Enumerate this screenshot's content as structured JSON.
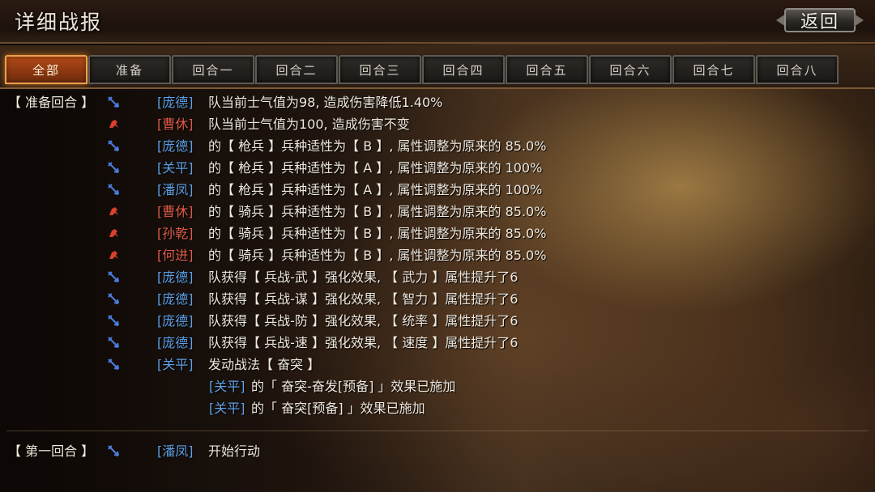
{
  "header": {
    "title": "详细战报",
    "back_label": "返回"
  },
  "tabs": [
    {
      "label": "全部",
      "active": true
    },
    {
      "label": "准备",
      "active": false
    },
    {
      "label": "回合一",
      "active": false
    },
    {
      "label": "回合二",
      "active": false
    },
    {
      "label": "回合三",
      "active": false
    },
    {
      "label": "回合四",
      "active": false
    },
    {
      "label": "回合五",
      "active": false
    },
    {
      "label": "回合六",
      "active": false
    },
    {
      "label": "回合七",
      "active": false
    },
    {
      "label": "回合八",
      "active": false
    }
  ],
  "colors": {
    "ally_blue": "#5ea0e6",
    "enemy_red": "#e05c4a",
    "tab_active": "#b34a16"
  },
  "icons": {
    "ally": "blue-arrow-icon",
    "enemy": "red-horse-icon"
  },
  "log": {
    "prep_round_label": "【 准备回合 】",
    "first_round_label": "【 第一回合 】",
    "rows": [
      {
        "side": "ally",
        "name": "[庞德]",
        "text": "队当前士气值为98, 造成伤害降低1.40%"
      },
      {
        "side": "enemy",
        "name": "[曹休]",
        "text": "队当前士气值为100, 造成伤害不变"
      },
      {
        "side": "ally",
        "name": "[庞德]",
        "text": "的【 枪兵 】兵种适性为【 B 】, 属性调整为原来的 85.0%"
      },
      {
        "side": "ally",
        "name": "[关平]",
        "text": "的【 枪兵 】兵种适性为【 A 】, 属性调整为原来的 100%"
      },
      {
        "side": "ally",
        "name": "[潘凤]",
        "text": "的【 枪兵 】兵种适性为【 A 】, 属性调整为原来的 100%"
      },
      {
        "side": "enemy",
        "name": "[曹休]",
        "text": "的【 骑兵 】兵种适性为【 B 】, 属性调整为原来的 85.0%"
      },
      {
        "side": "enemy",
        "name": "[孙乾]",
        "text": "的【 骑兵 】兵种适性为【 B 】, 属性调整为原来的 85.0%"
      },
      {
        "side": "enemy",
        "name": "[何进]",
        "text": "的【 骑兵 】兵种适性为【 B 】, 属性调整为原来的 85.0%"
      },
      {
        "side": "ally",
        "name": "[庞德]",
        "text": "队获得【 兵战-武 】强化效果, 【 武力 】属性提升了6"
      },
      {
        "side": "ally",
        "name": "[庞德]",
        "text": "队获得【 兵战-谋 】强化效果, 【 智力 】属性提升了6"
      },
      {
        "side": "ally",
        "name": "[庞德]",
        "text": "队获得【 兵战-防 】强化效果, 【 统率 】属性提升了6"
      },
      {
        "side": "ally",
        "name": "[庞德]",
        "text": "队获得【 兵战-速 】强化效果, 【 速度 】属性提升了6"
      },
      {
        "side": "ally",
        "name": "[关平]",
        "text": "发动战法【 奋突 】"
      }
    ],
    "sub_rows": [
      {
        "name": "[关平]",
        "text": "的「 奋突-奋发[预备] 」效果已施加"
      },
      {
        "name": "[关平]",
        "text": "的「 奋突[预备] 」效果已施加"
      }
    ],
    "first_round_row": {
      "side": "ally",
      "name": "[潘凤]",
      "text": "开始行动"
    }
  }
}
